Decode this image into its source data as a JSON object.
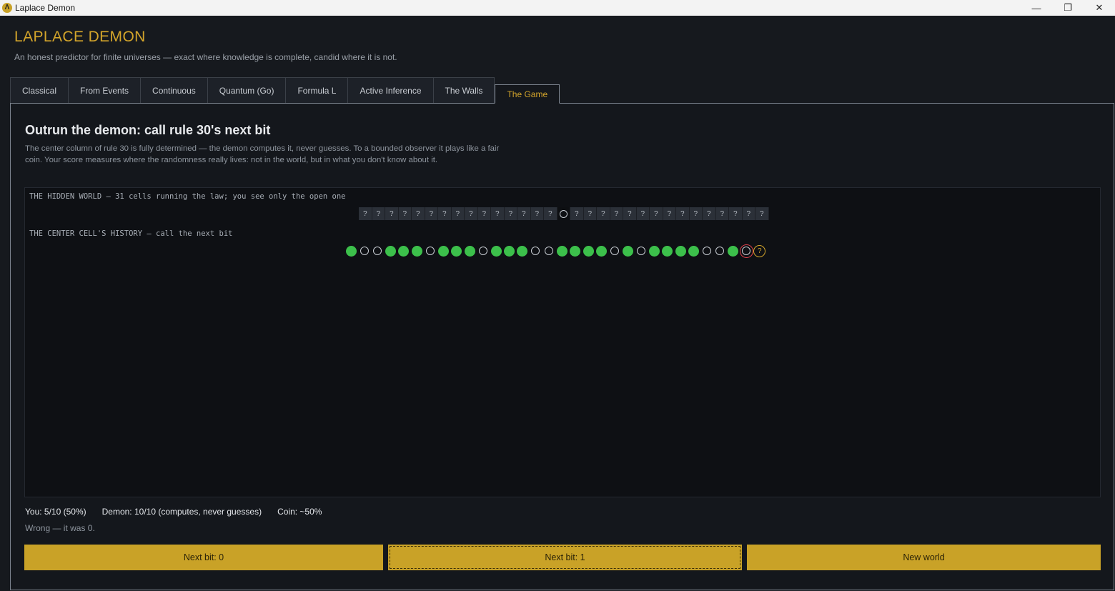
{
  "window": {
    "title": "Laplace Demon",
    "app_icon_glyph": "Λ",
    "minimize": "—",
    "restore": "❐",
    "close": "✕"
  },
  "header": {
    "title": "LAPLACE  DEMON",
    "subtitle": "An honest predictor for finite universes — exact where knowledge is complete, candid where it is not."
  },
  "tabs": [
    {
      "label": "Classical",
      "active": false
    },
    {
      "label": "From Events",
      "active": false
    },
    {
      "label": "Continuous",
      "active": false
    },
    {
      "label": "Quantum (Go)",
      "active": false
    },
    {
      "label": "Formula L",
      "active": false
    },
    {
      "label": "Active Inference",
      "active": false
    },
    {
      "label": "The Walls",
      "active": false
    },
    {
      "label": "The Game",
      "active": true
    }
  ],
  "game": {
    "heading": "Outrun the demon: call rule 30's next bit",
    "description": "The center column of rule 30 is fully determined — the demon computes it, never guesses. To a bounded observer it plays like a fair coin. Your score measures where the randomness really lives: not in the world, but in what you don't know about it.",
    "world_label": "THE HIDDEN WORLD — 31 cells running the law; you see only the open one",
    "hidden_cell_glyph": "?",
    "cell_count": 31,
    "open_cell_index": 15,
    "history_label": "THE CENTER CELL'S HISTORY — call the next bit",
    "history_bits": [
      1,
      0,
      0,
      1,
      1,
      1,
      0,
      1,
      1,
      1,
      0,
      1,
      1,
      1,
      0,
      0,
      1,
      1,
      1,
      1,
      0,
      1,
      0,
      1,
      1,
      1,
      1,
      0,
      0,
      1,
      0
    ],
    "last_bit_wrong": true,
    "next_glyph": "?",
    "score_you": "You: 5/10 (50%)",
    "score_demon": "Demon: 10/10 (computes, never guesses)",
    "score_coin": "Coin: ~50%",
    "feedback": "Wrong — it was 0.",
    "buttons": {
      "next0": "Next bit: 0",
      "next1": "Next bit: 1",
      "new_world": "New world"
    }
  },
  "colors": {
    "accent": "#d4a52b",
    "bit_one": "#3cc04b",
    "wrong": "#e0404b"
  }
}
